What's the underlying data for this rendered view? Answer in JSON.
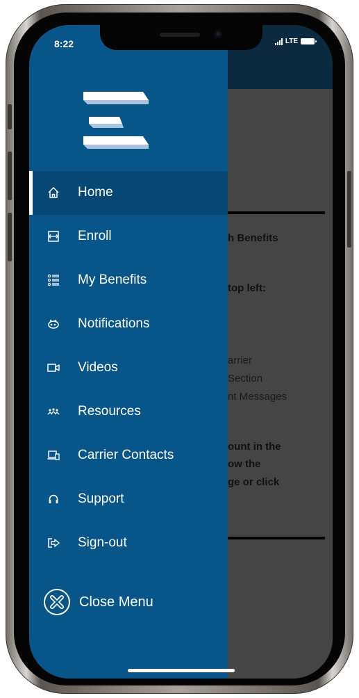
{
  "status_bar": {
    "time": "8:22",
    "network": "LTE"
  },
  "drawer": {
    "menu": [
      {
        "label": "Home",
        "icon": "home-icon",
        "active": true
      },
      {
        "label": "Enroll",
        "icon": "enroll-icon"
      },
      {
        "label": "My Benefits",
        "icon": "benefits-list-icon"
      },
      {
        "label": "Notifications",
        "icon": "notifications-icon"
      },
      {
        "label": "Videos",
        "icon": "video-camera-icon"
      },
      {
        "label": "Resources",
        "icon": "resources-icon"
      },
      {
        "label": "Carrier Contacts",
        "icon": "carrier-contacts-icon"
      },
      {
        "label": "Support",
        "icon": "headset-icon"
      },
      {
        "label": "Sign-out",
        "icon": "sign-out-icon"
      }
    ],
    "close_label": "Close Menu"
  },
  "background_content": {
    "line1": "h Benefits",
    "line2": "top left:",
    "line3": "arrier",
    "line4": "Section",
    "line5": "nt Messages",
    "line6": "ount in the",
    "line7": "ow the",
    "line8": "ge or click"
  },
  "colors": {
    "drawer": "#08558a",
    "drawer_active": "#064774",
    "header": "#0b2a40",
    "overlay": "#454545"
  }
}
